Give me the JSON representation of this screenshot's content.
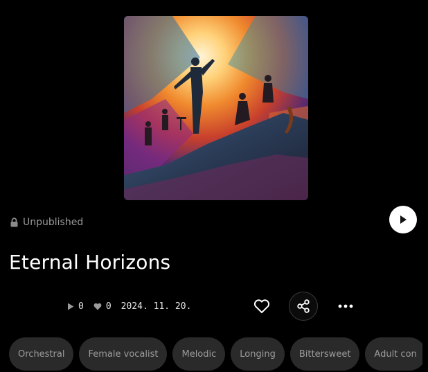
{
  "track": {
    "status": "Unpublished",
    "title": "Eternal Horizons",
    "plays": "0",
    "likes": "0",
    "date": "2024. 11. 20."
  },
  "tags": [
    "Orchestral",
    "Female vocalist",
    "Melodic",
    "Longing",
    "Bittersweet",
    "Adult con"
  ],
  "icons": {
    "status": "lock-icon",
    "play": "play-icon",
    "plays": "play-small-icon",
    "likes": "heart-small-icon",
    "like": "heart-outline-icon",
    "share": "share-icon",
    "more": "more-dots-icon"
  },
  "colors": {
    "background": "#000000",
    "muted_text": "#9a9a9a",
    "tag_background": "#2a2a2a"
  }
}
